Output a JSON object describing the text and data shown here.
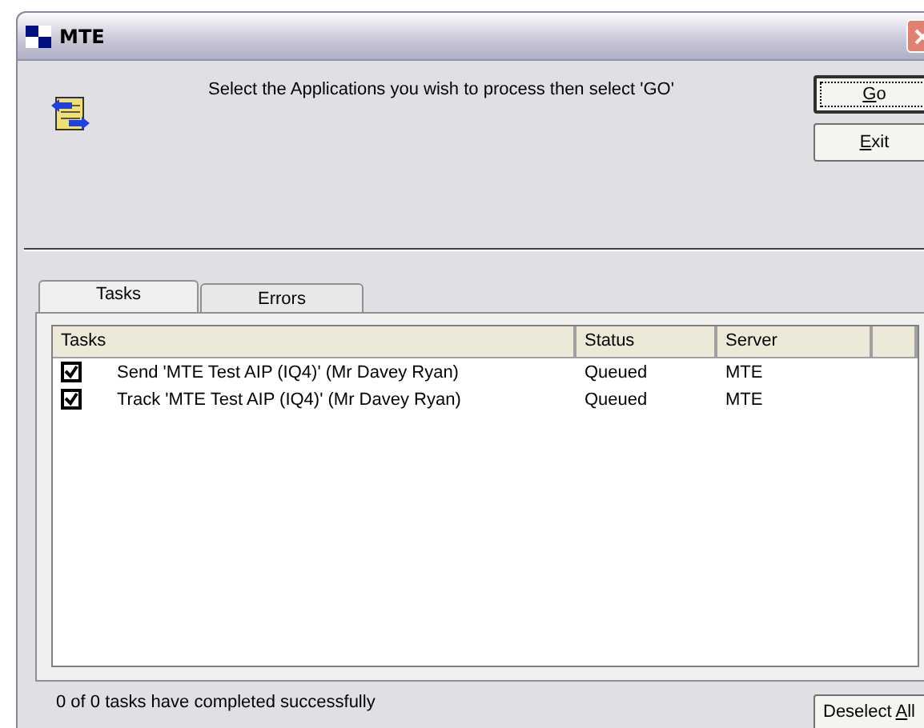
{
  "window": {
    "title": "MTE"
  },
  "instruction": "Select the Applications you wish to process then select 'GO'",
  "buttons": [
    {
      "key": "G",
      "after": "o",
      "default": true
    },
    {
      "key": "E",
      "after": "xit",
      "default": false
    }
  ],
  "tabs": [
    {
      "label": "Tasks",
      "selected": true
    },
    {
      "label": "Errors",
      "selected": false
    }
  ],
  "table": {
    "columns": [
      "Tasks",
      "Status",
      "Server"
    ],
    "rows": [
      {
        "checked": true,
        "task": "Send 'MTE Test AIP (IQ4)' (Mr Davey Ryan)",
        "status": "Queued",
        "server": "MTE"
      },
      {
        "checked": true,
        "task": "Track 'MTE Test AIP (IQ4)' (Mr Davey Ryan)",
        "status": "Queued",
        "server": "MTE"
      }
    ]
  },
  "status_text": "0 of 0 tasks have completed successfully",
  "deselect_button": {
    "before": "Deselect ",
    "key": "A",
    "after": "ll"
  }
}
